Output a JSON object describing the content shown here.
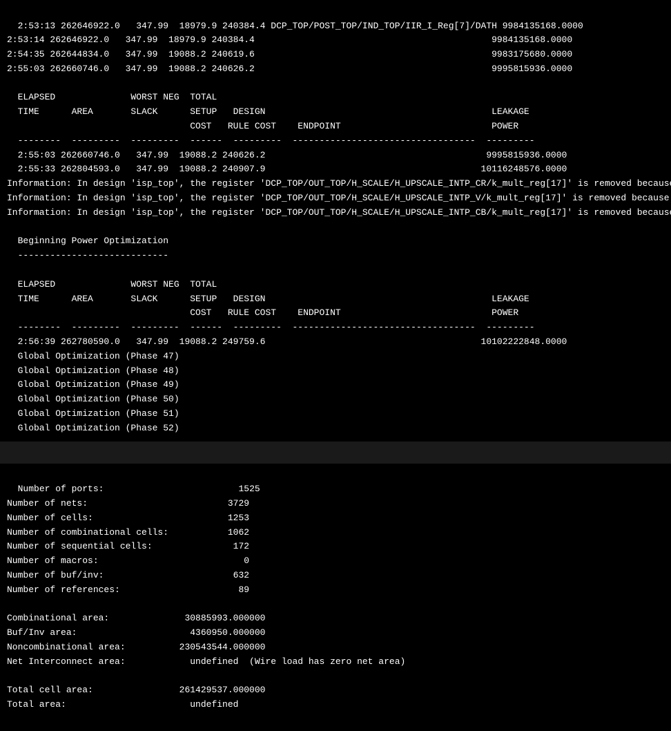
{
  "top_terminal": {
    "lines": [
      "2:53:13 262646922.0   347.99  18979.9 240384.4 DCP_TOP/POST_TOP/IND_TOP/IIR_I_Reg[7]/DATH 9984135168.0000",
      "2:53:14 262646922.0   347.99  18979.9 240384.4                                            9984135168.0000",
      "2:54:35 262644834.0   347.99  19088.2 240619.6                                            9983175680.0000",
      "2:55:03 262660746.0   347.99  19088.2 240626.2                                            9995815936.0000",
      "",
      "  ELAPSED              WORST NEG  TOTAL",
      "  TIME      AREA       SLACK      SETUP   DESIGN                                          LEAKAGE",
      "                                  COST   RULE COST    ENDPOINT                            POWER",
      "  --------  ---------  ---------  ------  ---------  ----------------------------------  ---------",
      "  2:55:03 262660746.0   347.99  19088.2 240626.2                                         9995815936.0000",
      "  2:55:33 262804593.0   347.99  19088.2 240907.9                                        10116248576.0000",
      "Information: In design 'isp_top', the register 'DCP_TOP/OUT_TOP/H_SCALE/H_UPSCALE_INTP_CR/k_mult_reg[17]' is removed because it",
      "Information: In design 'isp_top', the register 'DCP_TOP/OUT_TOP/H_SCALE/H_UPSCALE_INTP_V/k_mult_reg[17]' is removed because it ",
      "Information: In design 'isp_top', the register 'DCP_TOP/OUT_TOP/H_SCALE/H_UPSCALE_INTP_CB/k_mult_reg[17]' is removed because it",
      "",
      "  Beginning Power Optimization",
      "  ----------------------------",
      "",
      "  ELAPSED              WORST NEG  TOTAL",
      "  TIME      AREA       SLACK      SETUP   DESIGN                                          LEAKAGE",
      "                                  COST   RULE COST    ENDPOINT                            POWER",
      "  --------  ---------  ---------  ------  ---------  ----------------------------------  ---------",
      "  2:56:39 262780590.0   347.99  19088.2 249759.6                                        10102222848.0000",
      "  Global Optimization (Phase 47)",
      "  Global Optimization (Phase 48)",
      "  Global Optimization (Phase 49)",
      "  Global Optimization (Phase 50)",
      "  Global Optimization (Phase 51)",
      "  Global Optimization (Phase 52)"
    ]
  },
  "bottom_terminal": {
    "lines": [
      "Number of ports:                         1525",
      "Number of nets:                          3729",
      "Number of cells:                         1253",
      "Number of combinational cells:           1062",
      "Number of sequential cells:               172",
      "Number of macros:                           0",
      "Number of buf/inv:                        632",
      "Number of references:                      89",
      "",
      "Combinational area:              30885993.000000",
      "Buf/Inv area:                     4360950.000000",
      "Noncombinational area:          230543544.000000",
      "Net Interconnect area:            undefined  (Wire load has zero net area)",
      "",
      "Total cell area:                261429537.000000",
      "Total area:                       undefined",
      ""
    ]
  }
}
